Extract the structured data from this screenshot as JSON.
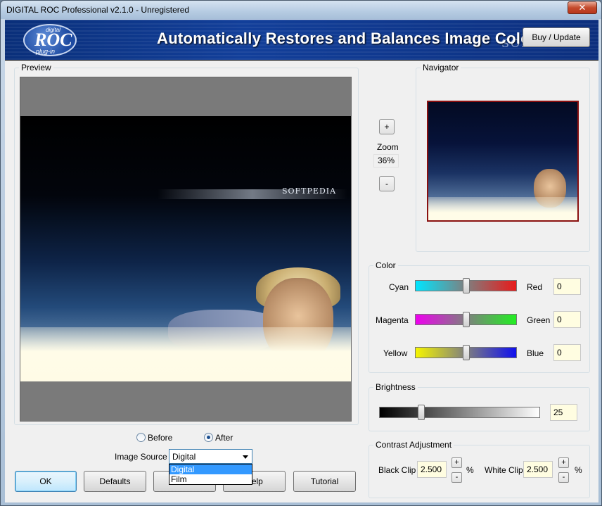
{
  "window": {
    "title": "DIGITAL ROC Professional v2.1.0 - Unregistered",
    "close_glyph": "✕"
  },
  "banner": {
    "logo_small": "digital",
    "logo_main": "ROC",
    "logo_sub": "plug-in",
    "headline": "Automatically Restores and Balances Image Color",
    "watermark": "SOFTPEDIA",
    "buy_label": "Buy / Update"
  },
  "preview": {
    "label": "Preview",
    "photo_text": "SOFTPEDIA",
    "before_label": "Before",
    "after_label": "After",
    "selected": "After",
    "image_source_label": "Image Source",
    "image_source_value": "Digital",
    "image_source_options": [
      "Digital",
      "Film"
    ],
    "image_source_highlighted": "Digital"
  },
  "zoom": {
    "plus": "+",
    "label": "Zoom",
    "value": "36%",
    "minus": "-"
  },
  "navigator": {
    "label": "Navigator"
  },
  "color": {
    "label": "Color",
    "rows": [
      {
        "left": "Cyan",
        "right": "Red",
        "value": "0",
        "level": 0.5
      },
      {
        "left": "Magenta",
        "right": "Green",
        "value": "0",
        "level": 0.5
      },
      {
        "left": "Yellow",
        "right": "Blue",
        "value": "0",
        "level": 0.5
      }
    ]
  },
  "brightness": {
    "label": "Brightness",
    "value": "25",
    "level": 0.25
  },
  "contrast": {
    "label": "Contrast Adjustment",
    "black_clip_label": "Black Clip",
    "black_clip_value": "2.500",
    "white_clip_label": "White Clip",
    "white_clip_value": "2.500",
    "plus": "+",
    "minus": "-",
    "unit": "%"
  },
  "buttons": {
    "ok": "OK",
    "defaults": "Defaults",
    "cancel": "Cancel",
    "help": "Help",
    "tutorial": "Tutorial"
  },
  "colors": {
    "cyan": "#00e5ff",
    "red": "#e81a1a",
    "magenta": "#ee00ee",
    "green": "#22ee22",
    "yellow": "#f5f500",
    "blue": "#1010ee"
  }
}
